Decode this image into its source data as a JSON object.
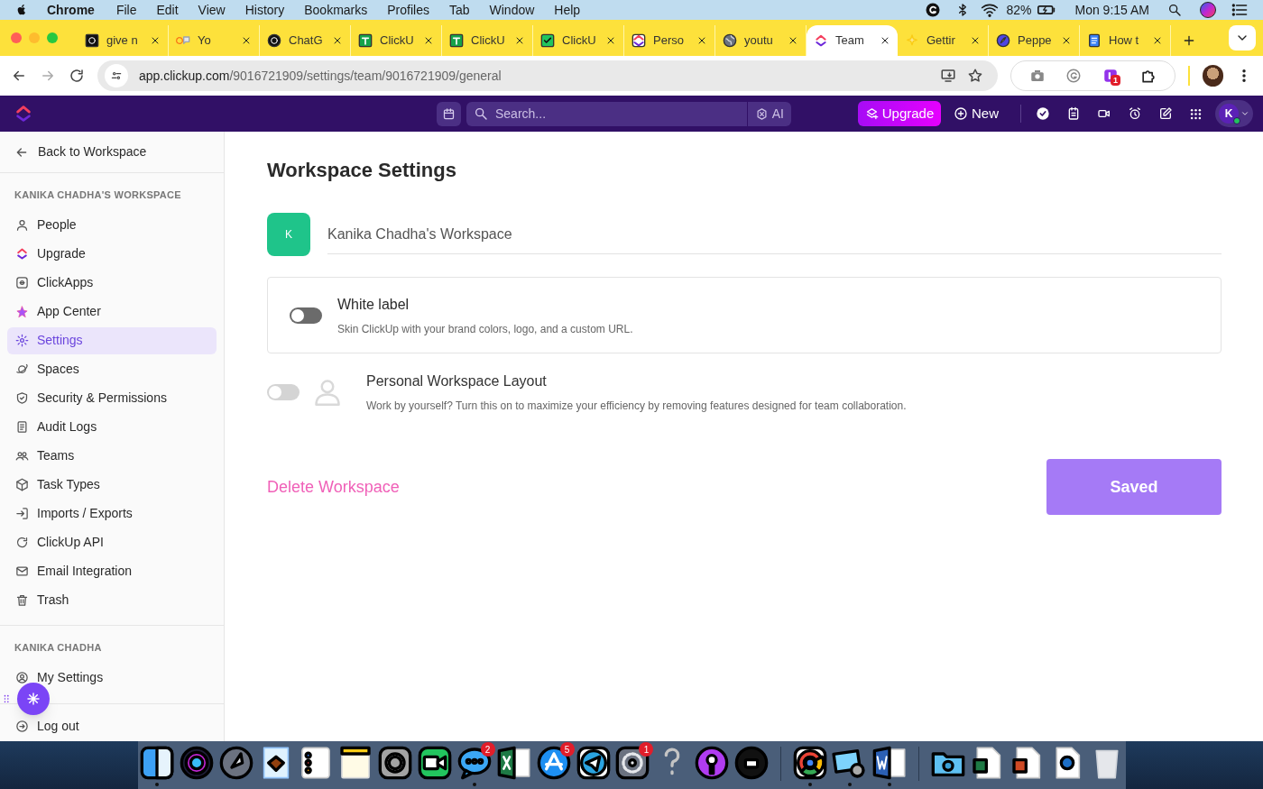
{
  "menu_bar": {
    "app": "Chrome",
    "menus": [
      "File",
      "Edit",
      "View",
      "History",
      "Bookmarks",
      "Profiles",
      "Tab",
      "Window",
      "Help"
    ],
    "battery_percent": "82%",
    "clock": "Mon 9:15 AM"
  },
  "browser": {
    "tabs": [
      {
        "title": "give n",
        "selected": false
      },
      {
        "title": "Yo",
        "selected": false
      },
      {
        "title": "ChatG",
        "selected": false
      },
      {
        "title": "ClickU",
        "selected": false
      },
      {
        "title": "ClickU",
        "selected": false
      },
      {
        "title": "ClickU",
        "selected": false
      },
      {
        "title": "Perso",
        "selected": false
      },
      {
        "title": "youtu",
        "selected": false
      },
      {
        "title": "Team",
        "selected": true
      },
      {
        "title": "Gettir",
        "selected": false
      },
      {
        "title": "Peppe",
        "selected": false
      },
      {
        "title": "How t",
        "selected": false
      }
    ],
    "address": {
      "host": "app.clickup.com",
      "path": "/9016721909/settings/team/9016721909/general"
    },
    "extension_badge": "1"
  },
  "app_header": {
    "search": {
      "placeholder": "Search..."
    },
    "ai_label": "AI",
    "upgrade": "Upgrade",
    "new": "New",
    "avatar_initial": "K"
  },
  "sidebar": {
    "back": "Back to Workspace",
    "sections": [
      {
        "title": "KANIKA CHADHA'S WORKSPACE",
        "items": [
          {
            "label": "People",
            "selected": false
          },
          {
            "label": "Upgrade",
            "selected": false
          },
          {
            "label": "ClickApps",
            "selected": false
          },
          {
            "label": "App Center",
            "selected": false
          },
          {
            "label": "Settings",
            "selected": true
          },
          {
            "label": "Spaces",
            "selected": false
          },
          {
            "label": "Security & Permissions",
            "selected": false
          },
          {
            "label": "Audit Logs",
            "selected": false
          },
          {
            "label": "Teams",
            "selected": false
          },
          {
            "label": "Task Types",
            "selected": false
          },
          {
            "label": "Imports / Exports",
            "selected": false
          },
          {
            "label": "ClickUp API",
            "selected": false
          },
          {
            "label": "Email Integration",
            "selected": false
          },
          {
            "label": "Trash",
            "selected": false
          }
        ]
      },
      {
        "title": "KANIKA CHADHA",
        "items": [
          {
            "label": "My Settings",
            "selected": false
          }
        ]
      }
    ],
    "logout": "Log out"
  },
  "main": {
    "title": "Workspace Settings",
    "workspace_avatar": "K",
    "workspace_name": "Kanika Chadha's Workspace",
    "options": [
      {
        "kind": "card",
        "title": "White label",
        "description": "Skin ClickUp with your brand colors, logo, and a custom URL.",
        "on": false,
        "disabled": false
      },
      {
        "kind": "row",
        "title": "Personal Workspace Layout",
        "description": "Work by yourself? Turn this on to maximize your efficiency by removing features designed for team collaboration.",
        "on": false,
        "disabled": true
      }
    ],
    "delete_link": "Delete Workspace",
    "save_button": "Saved"
  },
  "dock": [
    {
      "kind": "app",
      "running": true
    },
    {
      "kind": "app",
      "running": false
    },
    {
      "kind": "app",
      "running": false
    },
    {
      "kind": "app",
      "running": false
    },
    {
      "kind": "app",
      "running": false
    },
    {
      "kind": "app",
      "running": false
    },
    {
      "kind": "app",
      "running": false
    },
    {
      "kind": "app",
      "running": false
    },
    {
      "kind": "app",
      "running": true,
      "badge": "2"
    },
    {
      "kind": "app",
      "running": false
    },
    {
      "kind": "app",
      "running": false,
      "badge": "5"
    },
    {
      "kind": "app",
      "running": false
    },
    {
      "kind": "app",
      "running": false,
      "badge": "1"
    },
    {
      "kind": "app",
      "running": false
    },
    {
      "kind": "app",
      "running": false
    },
    {
      "kind": "app",
      "running": false
    },
    {
      "kind": "separator"
    },
    {
      "kind": "app",
      "running": true
    },
    {
      "kind": "app",
      "running": true
    },
    {
      "kind": "app",
      "running": true
    },
    {
      "kind": "separator"
    },
    {
      "kind": "app",
      "running": false
    },
    {
      "kind": "app",
      "running": false
    },
    {
      "kind": "app",
      "running": false
    },
    {
      "kind": "app",
      "running": false
    },
    {
      "kind": "app",
      "running": false
    }
  ]
}
